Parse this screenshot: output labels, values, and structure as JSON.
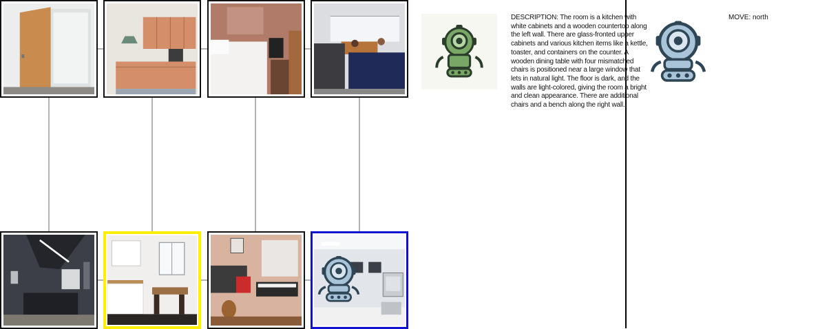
{
  "rooms_top": [
    {
      "name": "closet",
      "highlight": "none"
    },
    {
      "name": "kitchenette",
      "highlight": "none"
    },
    {
      "name": "bedroom",
      "highlight": "none"
    },
    {
      "name": "reception",
      "highlight": "none"
    }
  ],
  "rooms_bottom": [
    {
      "name": "home-theater",
      "highlight": "none"
    },
    {
      "name": "kitchen-dining",
      "highlight": "yellow"
    },
    {
      "name": "music-room",
      "highlight": "none"
    },
    {
      "name": "computer-lab",
      "highlight": "blue"
    }
  ],
  "description": "DESCRIPTION: The room is a kitchen with white cabinets and a wooden countertop along the left wall. There are glass-fronted upper cabinets and various kitchen items like a kettle, toaster, and containers on the counter. A wooden dining table with four mismatched chairs is positioned near a large window that lets in natural light. The floor is dark, and the walls are light-colored, giving the room a bright and clean appearance. There are additional chairs and a bench along the right wall.",
  "move": "MOVE: north",
  "icons": {
    "agent_a": "green-robot-icon",
    "agent_b": "blue-robot-icon"
  },
  "colors": {
    "visited_highlight": "#ffee00",
    "current_highlight": "#1010d0",
    "robot_green": "#6e9a5a",
    "robot_blue": "#a9c4d8"
  }
}
